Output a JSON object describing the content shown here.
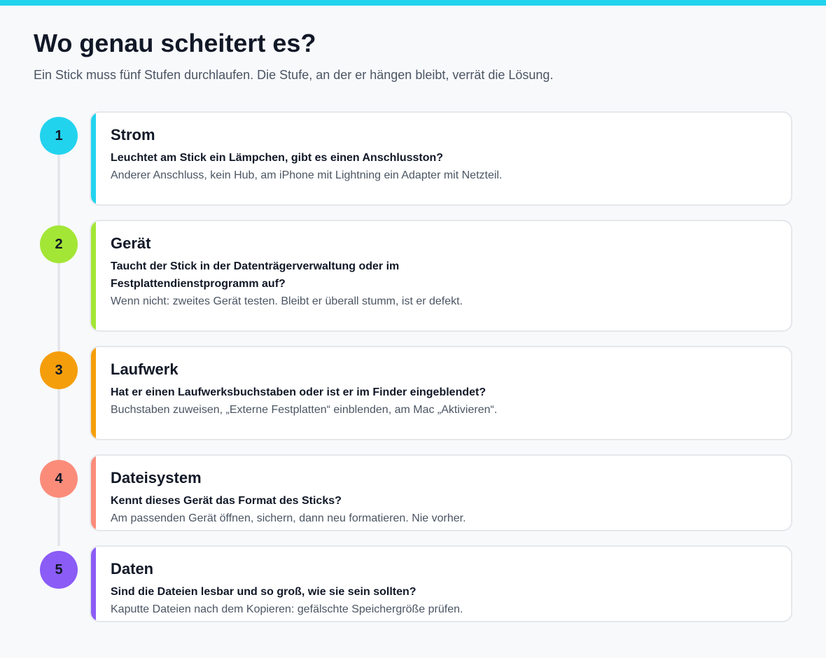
{
  "header": {
    "title": "Wo genau scheitert es?",
    "subtitle": "Ein Stick muss fünf Stufen durchlaufen. Die Stufe, an der er hängen bleibt, verrät die Lösung."
  },
  "colors": {
    "top_bar": "#22d3ee",
    "step_1": "#22d3ee",
    "step_2": "#a3e635",
    "step_3": "#f59e0b",
    "step_4": "#fb8c7a",
    "step_5": "#8b5cf6"
  },
  "steps": [
    {
      "number": "1",
      "title": "Strom",
      "question": "Leuchtet am Stick ein Lämpchen, gibt es einen Anschlusston?",
      "hint": "Anderer Anschluss, kein Hub, am iPhone mit Lightning ein Adapter mit Netzteil."
    },
    {
      "number": "2",
      "title": "Gerät",
      "question": "Taucht der Stick in der Datenträgerverwaltung oder im Festplattendienstprogramm auf?",
      "hint": "Wenn nicht: zweites Gerät testen. Bleibt er überall stumm, ist er defekt."
    },
    {
      "number": "3",
      "title": "Laufwerk",
      "question": "Hat er einen Laufwerksbuchstaben oder ist er im Finder eingeblendet?",
      "hint": "Buchstaben zuweisen, „Externe Festplatten“ einblenden, am Mac „Aktivieren“."
    },
    {
      "number": "4",
      "title": "Dateisystem",
      "question": "Kennt dieses Gerät das Format des Sticks?",
      "hint": "Am passenden Gerät öffnen, sichern, dann neu formatieren. Nie vorher."
    },
    {
      "number": "5",
      "title": "Daten",
      "question": "Sind die Dateien lesbar und so groß, wie sie sein sollten?",
      "hint": "Kaputte Dateien nach dem Kopieren: gefälschte Speichergröße prüfen."
    }
  ]
}
